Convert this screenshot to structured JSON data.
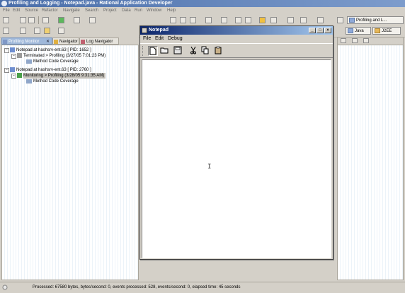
{
  "window": {
    "title": "Profiling and Logging - Notepad.java - Rational Application Developer"
  },
  "menu": [
    "File",
    "Edit",
    "Source",
    "Refactor",
    "Navigate",
    "Search",
    "Project",
    "Data",
    "Run",
    "Window",
    "Help"
  ],
  "perspectives": {
    "profiling": "Profiling and L...",
    "java": "Java",
    "j2ee": "J2EE"
  },
  "tabs": {
    "profiling_monitor": "Profiling Monitor",
    "navigator": "Navigator",
    "log_navigator": "Log Navigator"
  },
  "tree": {
    "node1": "Notepad at hashsrv-ent.63 [ PID: 1652 ]",
    "node1_child": "Terminated > Profiling (3/27/05 7:01:23 PM)",
    "node1_grandchild": "Method Code Coverage",
    "node2": "Notepad at hashsrv-ent.63 [ PID: 2760 ]",
    "node2_child": "Monitoring > Profiling (3/28/05 9:31:35 AM)",
    "node2_grandchild": "Method Code Coverage"
  },
  "notepad": {
    "title": "Notepad",
    "menu": {
      "file": "File",
      "edit": "Edit",
      "debug": "Debug"
    },
    "cursor": "I"
  },
  "status": {
    "text": "Processed: 67580 bytes, bytes/second: 0, events processed: 528, events/second: 0, elapsed time: 45 seconds"
  }
}
